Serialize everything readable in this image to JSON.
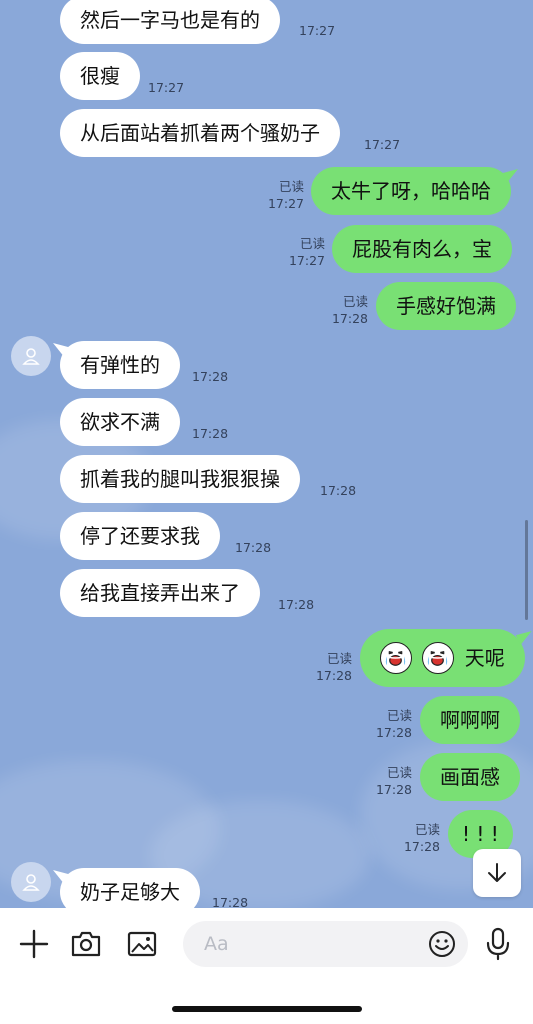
{
  "colors": {
    "chat_background": "#8aa8d9",
    "incoming_bubble": "#ffffff",
    "outgoing_bubble": "#79e074",
    "meta_text": "#34425c"
  },
  "messages": [
    {
      "dir": "in",
      "text": "然后一字马也是有的",
      "time": "17:27"
    },
    {
      "dir": "in",
      "text": "很瘦",
      "time": "17:27"
    },
    {
      "dir": "in",
      "text": "从后面站着抓着两个骚奶子",
      "time": "17:27"
    },
    {
      "dir": "out",
      "text": "太牛了呀，哈哈哈",
      "read": "已读",
      "time": "17:27"
    },
    {
      "dir": "out",
      "text": "屁股有肉么，宝",
      "read": "已读",
      "time": "17:27"
    },
    {
      "dir": "out",
      "text": "手感好饱满",
      "read": "已读",
      "time": "17:28"
    },
    {
      "dir": "in",
      "text": "有弹性的",
      "time": "17:28"
    },
    {
      "dir": "in",
      "text": "欲求不满",
      "time": "17:28"
    },
    {
      "dir": "in",
      "text": "抓着我的腿叫我狠狠操",
      "time": "17:28"
    },
    {
      "dir": "in",
      "text": "停了还要求我",
      "time": "17:28"
    },
    {
      "dir": "in",
      "text": "给我直接弄出来了",
      "time": "17:28"
    },
    {
      "dir": "out",
      "text": "天呢",
      "read": "已读",
      "time": "17:28",
      "emoji": [
        "crying-laughing-face-icon",
        "crying-laughing-face-icon"
      ]
    },
    {
      "dir": "out",
      "text": "啊啊啊",
      "read": "已读",
      "time": "17:28"
    },
    {
      "dir": "out",
      "text": "画面感",
      "read": "已读",
      "time": "17:28"
    },
    {
      "dir": "out",
      "text": "! ! !",
      "read": "已读",
      "time": "17:28"
    },
    {
      "dir": "in",
      "text": "奶子足够大",
      "time": "17:28"
    }
  ],
  "input": {
    "placeholder": "Aa"
  },
  "toolbar_icons": [
    "plus-icon",
    "camera-icon",
    "image-icon",
    "emoji-icon",
    "microphone-icon"
  ],
  "scroll_button_icon": "arrow-down-icon"
}
